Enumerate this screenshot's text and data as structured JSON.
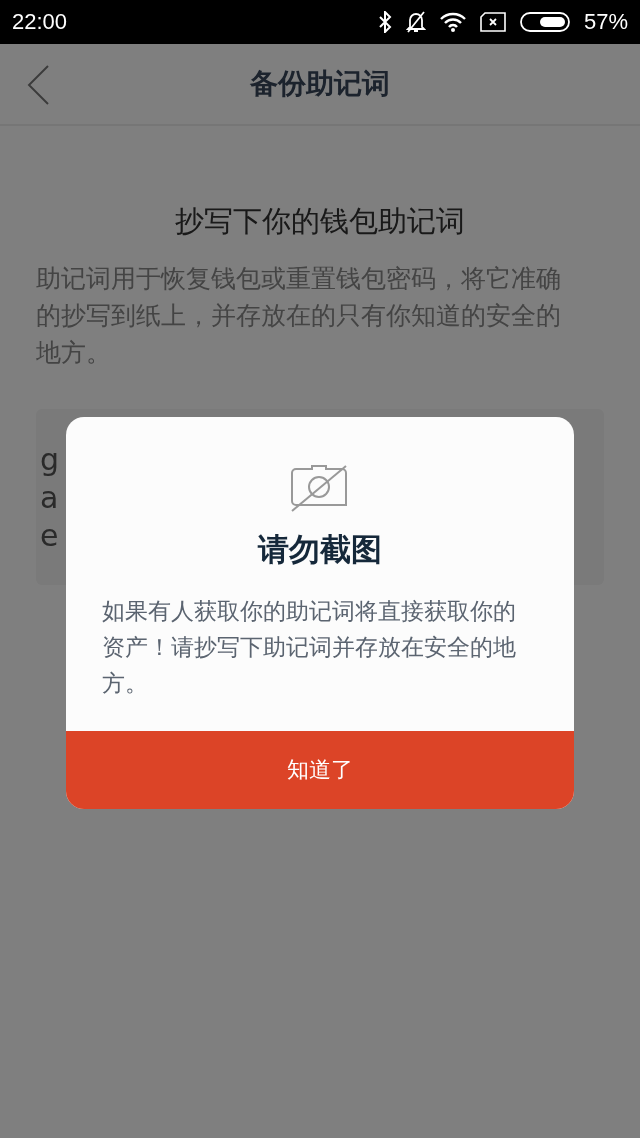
{
  "status_bar": {
    "time": "22:00",
    "battery": "57%"
  },
  "nav": {
    "title": "备份助记词"
  },
  "heading": "抄写下你的钱包助记词",
  "description": "助记词用于恢复钱包或重置钱包密码，将它准确的抄写到纸上，并存放在的只有你知道的安全的地方。",
  "mnemonic_lines": [
    "g",
    "a",
    "e"
  ],
  "dialog": {
    "title": "请勿截图",
    "message": "如果有人获取你的助记词将直接获取你的资产！请抄写下助记词并存放在安全的地方。",
    "button": "知道了"
  }
}
